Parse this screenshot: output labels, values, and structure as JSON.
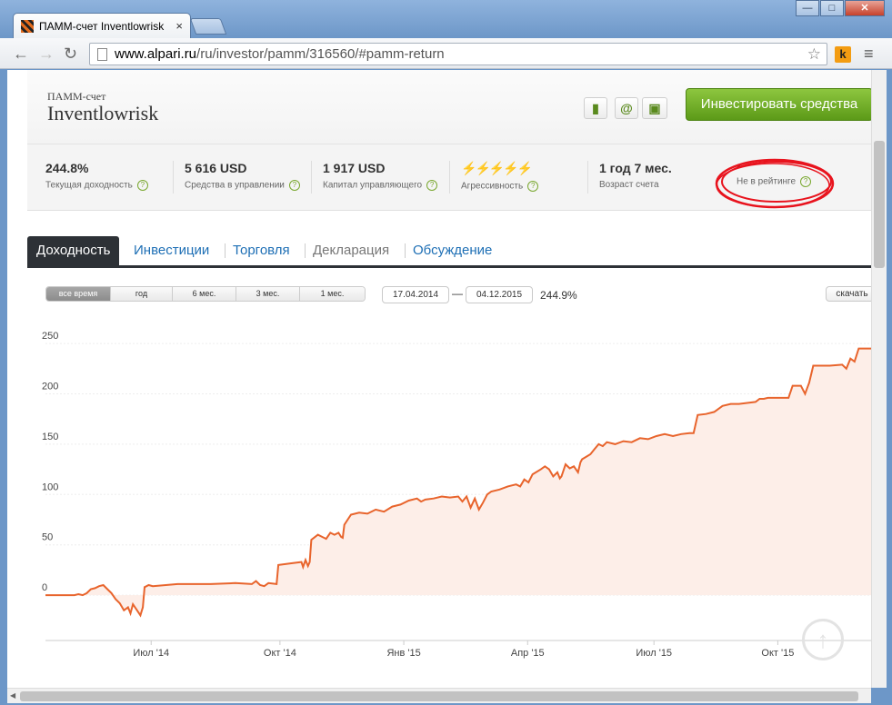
{
  "browser": {
    "tab_title": "ПАММ-счет Inventlowrisk",
    "tab_close": "×",
    "url_domain": "www.alpari.ru",
    "url_path": "/ru/investor/pamm/316560/#pamm-return",
    "back": "←",
    "forward": "→",
    "reload": "↻",
    "star": "☆",
    "ext_label": "k",
    "menu": "≡",
    "win_min": "—",
    "win_max": "□",
    "win_close": "✕"
  },
  "account": {
    "subtitle": "ПАММ-счет",
    "name": "Inventlowrisk",
    "bookmark_icon": "▮",
    "email_icon": "@",
    "briefcase_icon": "▣",
    "invest_label": "Инвестировать средства",
    "help_mark": "?",
    "stats": [
      {
        "value": "244.8%",
        "label": "Текущая доходность"
      },
      {
        "value": "5 616 USD",
        "label": "Средства в управлении"
      },
      {
        "value": "1 917 USD",
        "label": "Капитал управляющего"
      },
      {
        "value": "",
        "label": "Агрессивность"
      },
      {
        "value": "1 год 7 мес.",
        "label": "Возраст счета"
      },
      {
        "value": "–",
        "label": "Не в рейтинге"
      }
    ],
    "aggressiveness_level": 3,
    "aggressiveness_max": 5,
    "bolt_glyph": "⚡"
  },
  "tabs": [
    {
      "label": "Доходность",
      "active": true
    },
    {
      "label": "Инвестиции"
    },
    {
      "label": "Торговля"
    },
    {
      "label": "Декларация"
    },
    {
      "label": "Обсуждение"
    }
  ],
  "range": {
    "periods": [
      "все время",
      "год",
      "6 мес.",
      "3 мес.",
      "1 мес."
    ],
    "date_from": "17.04.2014",
    "date_to": "04.12.2015",
    "dash": "—",
    "return": "244.9%",
    "download": "скачать",
    "up_arrow": "↑"
  },
  "chart_data": {
    "type": "area",
    "y_ticks": [
      0,
      50,
      100,
      150,
      200,
      250
    ],
    "ylim": [
      -45,
      260
    ],
    "x_ticks": [
      "Июл '14",
      "Окт '14",
      "Янв '15",
      "Апр '15",
      "Июл '15",
      "Окт '15"
    ],
    "line_color": "#e8642c",
    "fill_color": "#fdeee8",
    "grid": true,
    "series": [
      {
        "values": [
          [
            0,
            0
          ],
          [
            0.035,
            0
          ],
          [
            0.04,
            1
          ],
          [
            0.045,
            0
          ],
          [
            0.05,
            2
          ],
          [
            0.055,
            6
          ],
          [
            0.06,
            7
          ],
          [
            0.065,
            9
          ],
          [
            0.07,
            10
          ],
          [
            0.075,
            6
          ],
          [
            0.08,
            2
          ],
          [
            0.085,
            -4
          ],
          [
            0.09,
            -8
          ],
          [
            0.095,
            -15
          ],
          [
            0.1,
            -12
          ],
          [
            0.103,
            -18
          ],
          [
            0.106,
            -9
          ],
          [
            0.11,
            -14
          ],
          [
            0.115,
            -20
          ],
          [
            0.118,
            -12
          ],
          [
            0.12,
            8
          ],
          [
            0.125,
            10
          ],
          [
            0.13,
            9
          ],
          [
            0.16,
            11
          ],
          [
            0.2,
            11
          ],
          [
            0.23,
            12
          ],
          [
            0.25,
            11
          ],
          [
            0.255,
            14
          ],
          [
            0.26,
            10
          ],
          [
            0.265,
            9
          ],
          [
            0.27,
            12
          ],
          [
            0.28,
            11
          ],
          [
            0.282,
            30
          ],
          [
            0.3,
            32
          ],
          [
            0.31,
            33
          ],
          [
            0.312,
            28
          ],
          [
            0.315,
            35
          ],
          [
            0.318,
            29
          ],
          [
            0.32,
            33
          ],
          [
            0.322,
            55
          ],
          [
            0.33,
            60
          ],
          [
            0.335,
            58
          ],
          [
            0.34,
            56
          ],
          [
            0.345,
            62
          ],
          [
            0.35,
            60
          ],
          [
            0.355,
            62
          ],
          [
            0.358,
            58
          ],
          [
            0.36,
            57
          ],
          [
            0.362,
            70
          ],
          [
            0.37,
            80
          ],
          [
            0.38,
            82
          ],
          [
            0.39,
            81
          ],
          [
            0.4,
            85
          ],
          [
            0.41,
            83
          ],
          [
            0.42,
            88
          ],
          [
            0.43,
            90
          ],
          [
            0.44,
            94
          ],
          [
            0.45,
            96
          ],
          [
            0.455,
            93
          ],
          [
            0.46,
            95
          ],
          [
            0.47,
            96
          ],
          [
            0.48,
            98
          ],
          [
            0.49,
            97
          ],
          [
            0.5,
            98
          ],
          [
            0.505,
            93
          ],
          [
            0.51,
            98
          ],
          [
            0.515,
            87
          ],
          [
            0.52,
            96
          ],
          [
            0.525,
            85
          ],
          [
            0.53,
            92
          ],
          [
            0.535,
            100
          ],
          [
            0.54,
            103
          ],
          [
            0.55,
            105
          ],
          [
            0.56,
            108
          ],
          [
            0.57,
            110
          ],
          [
            0.575,
            108
          ],
          [
            0.58,
            115
          ],
          [
            0.585,
            112
          ],
          [
            0.59,
            120
          ],
          [
            0.6,
            125
          ],
          [
            0.605,
            128
          ],
          [
            0.61,
            125
          ],
          [
            0.615,
            118
          ],
          [
            0.62,
            122
          ],
          [
            0.623,
            116
          ],
          [
            0.625,
            118
          ],
          [
            0.63,
            130
          ],
          [
            0.635,
            126
          ],
          [
            0.64,
            128
          ],
          [
            0.645,
            122
          ],
          [
            0.648,
            132
          ],
          [
            0.65,
            135
          ],
          [
            0.66,
            140
          ],
          [
            0.665,
            145
          ],
          [
            0.67,
            150
          ],
          [
            0.675,
            148
          ],
          [
            0.68,
            152
          ],
          [
            0.69,
            150
          ],
          [
            0.7,
            153
          ],
          [
            0.71,
            152
          ],
          [
            0.72,
            156
          ],
          [
            0.73,
            155
          ],
          [
            0.74,
            158
          ],
          [
            0.75,
            160
          ],
          [
            0.76,
            158
          ],
          [
            0.77,
            160
          ],
          [
            0.78,
            161
          ],
          [
            0.785,
            161
          ],
          [
            0.79,
            179
          ],
          [
            0.8,
            180
          ],
          [
            0.81,
            182
          ],
          [
            0.82,
            188
          ],
          [
            0.83,
            190
          ],
          [
            0.84,
            190
          ],
          [
            0.85,
            191
          ],
          [
            0.86,
            192
          ],
          [
            0.865,
            195
          ],
          [
            0.87,
            195
          ],
          [
            0.875,
            196
          ],
          [
            0.88,
            196
          ],
          [
            0.9,
            196
          ],
          [
            0.905,
            208
          ],
          [
            0.915,
            208
          ],
          [
            0.92,
            200
          ],
          [
            0.925,
            211
          ],
          [
            0.93,
            228
          ],
          [
            0.95,
            228
          ],
          [
            0.965,
            229
          ],
          [
            0.97,
            225
          ],
          [
            0.975,
            235
          ],
          [
            0.98,
            232
          ],
          [
            0.985,
            245
          ],
          [
            1.0,
            245
          ]
        ]
      }
    ]
  }
}
